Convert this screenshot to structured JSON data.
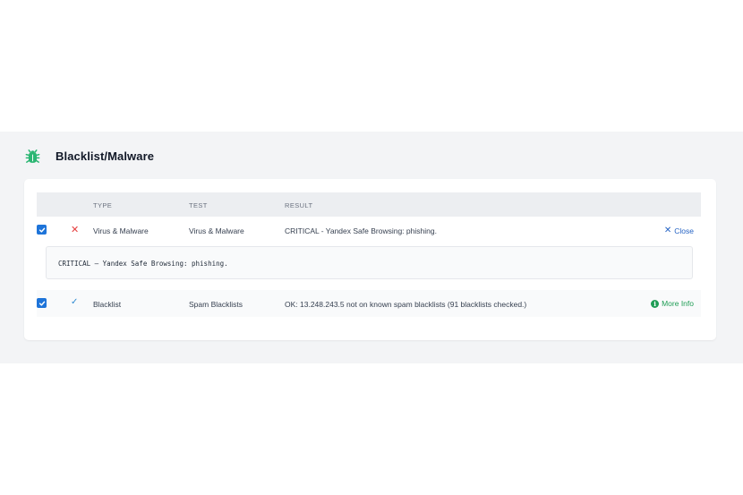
{
  "panel": {
    "title": "Blacklist/Malware",
    "icon": "bug-icon",
    "accent_color": "#2bb673"
  },
  "table": {
    "headers": {
      "type": "TYPE",
      "test": "TEST",
      "result": "RESULT"
    },
    "rows": [
      {
        "checked": true,
        "status": "fail",
        "status_icon": "x-icon",
        "type": "Virus & Malware",
        "test": "Virus & Malware",
        "result": "CRITICAL - Yandex Safe Browsing: phishing.",
        "action_label": "Close",
        "action_icon": "close-icon",
        "detail": "CRITICAL – Yandex Safe Browsing: phishing."
      },
      {
        "checked": true,
        "status": "pass",
        "status_icon": "check-icon",
        "type": "Blacklist",
        "test": "Spam Blacklists",
        "result": "OK: 13.248.243.5 not on known spam blacklists (91 blacklists checked.)",
        "action_label": "More Info",
        "action_icon": "info-icon"
      }
    ]
  },
  "colors": {
    "fail": "#e53e3e",
    "pass": "#2f8ad1",
    "link": "#2563c4",
    "more_info": "#1f9d55",
    "checkbox": "#1e74d9"
  }
}
